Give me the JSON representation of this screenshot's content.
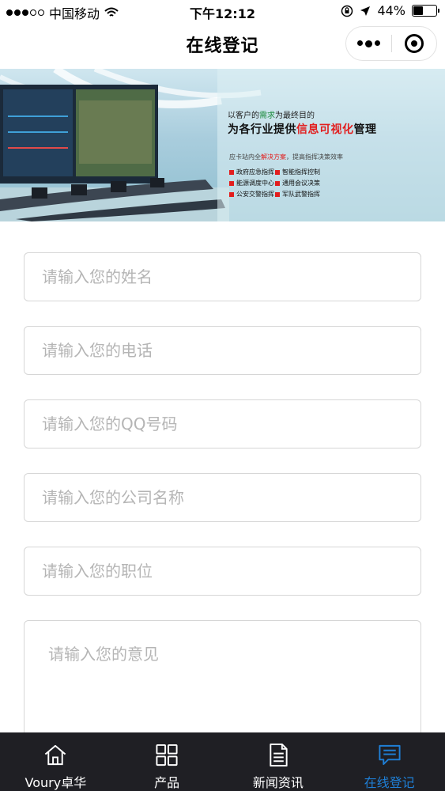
{
  "status_bar": {
    "carrier": "中国移动",
    "time": "下午12:12",
    "battery_text": "44%",
    "battery_level": 0.44
  },
  "nav": {
    "title": "在线登记"
  },
  "banner": {
    "tagline_prefix": "以客户的",
    "tagline_highlight": "需求",
    "tagline_suffix": "为最终目的",
    "headline_prefix": "为各行业提供",
    "headline_highlight": "信息可视化",
    "headline_suffix": "管理",
    "subline_prefix": "应卡站内全",
    "subline_highlight": "解决方案",
    "subline_suffix": "，提高指挥决策效率",
    "list": [
      "政府应急指挥",
      "智能指挥控制",
      "能源调度中心",
      "通用会议决策",
      "公安交警指挥",
      "军队武警指挥"
    ]
  },
  "form": {
    "name_placeholder": "请输入您的姓名",
    "phone_placeholder": "请输入您的电话",
    "qq_placeholder": "请输入您的QQ号码",
    "company_placeholder": "请输入您的公司名称",
    "position_placeholder": "请输入您的职位",
    "opinion_placeholder": "请输入您的意见"
  },
  "tabs": [
    {
      "label": "Voury卓华",
      "icon": "home-icon"
    },
    {
      "label": "产品",
      "icon": "grid-icon"
    },
    {
      "label": "新闻资讯",
      "icon": "document-icon"
    },
    {
      "label": "在线登记",
      "icon": "message-icon"
    }
  ],
  "colors": {
    "tab_bar_bg": "#1f1f24",
    "tab_active": "#1f7fd6",
    "tab_inactive": "#ffffff",
    "field_border": "#d6d6d6",
    "placeholder": "#b5b5b5"
  }
}
